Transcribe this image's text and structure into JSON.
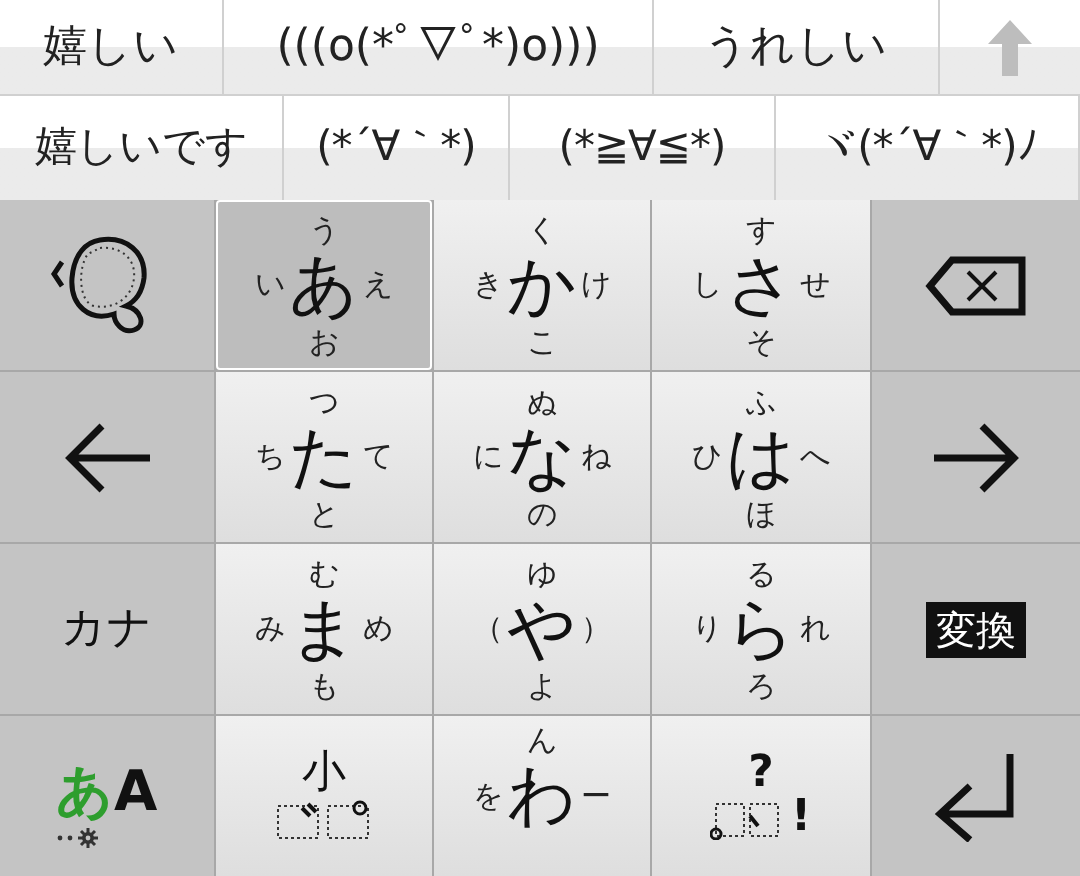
{
  "candidates": {
    "rows": [
      [
        {
          "text": "嬉しい"
        },
        {
          "text": "(((o(*ﾟ▽ﾟ*)o)))"
        },
        {
          "text": "うれしい"
        }
      ],
      [
        {
          "text": "嬉しいです"
        },
        {
          "text": "(*´∀｀*)"
        },
        {
          "text": "(*≧∀≦*)"
        },
        {
          "text": "ヾ(*´∀｀*)ﾉ"
        }
      ]
    ]
  },
  "keys": [
    {
      "kind": "undo"
    },
    {
      "kind": "flick",
      "main": "あ",
      "up": "う",
      "left": "い",
      "right": "え",
      "down": "お",
      "selected": true
    },
    {
      "kind": "flick",
      "main": "か",
      "up": "く",
      "left": "き",
      "right": "け",
      "down": "こ",
      "selected": false
    },
    {
      "kind": "flick",
      "main": "さ",
      "up": "す",
      "left": "し",
      "right": "せ",
      "down": "そ",
      "selected": false
    },
    {
      "kind": "backspace"
    },
    {
      "kind": "left"
    },
    {
      "kind": "flick",
      "main": "た",
      "up": "つ",
      "left": "ち",
      "right": "て",
      "down": "と",
      "selected": false
    },
    {
      "kind": "flick",
      "main": "な",
      "up": "ぬ",
      "left": "に",
      "right": "ね",
      "down": "の",
      "selected": false
    },
    {
      "kind": "flick",
      "main": "は",
      "up": "ふ",
      "left": "ひ",
      "right": "へ",
      "down": "ほ",
      "selected": false
    },
    {
      "kind": "right"
    },
    {
      "kind": "label",
      "text": "カナ"
    },
    {
      "kind": "flick",
      "main": "ま",
      "up": "む",
      "left": "み",
      "right": "め",
      "down": "も",
      "selected": false
    },
    {
      "kind": "flick",
      "main": "や",
      "up": "ゆ",
      "left": "（",
      "right": "）",
      "down": "よ",
      "selected": false
    },
    {
      "kind": "flick",
      "main": "ら",
      "up": "る",
      "left": "り",
      "right": "れ",
      "down": "ろ",
      "selected": false
    },
    {
      "kind": "convert",
      "text": "変換"
    },
    {
      "kind": "mode",
      "kana": "あ",
      "latin": "A"
    },
    {
      "kind": "small",
      "text": "小"
    },
    {
      "kind": "flick",
      "main": "わ",
      "up": "ん",
      "left": "を",
      "right": "ー",
      "selected": false
    },
    {
      "kind": "punct",
      "top": "?",
      "right": "!"
    },
    {
      "kind": "enter"
    }
  ]
}
